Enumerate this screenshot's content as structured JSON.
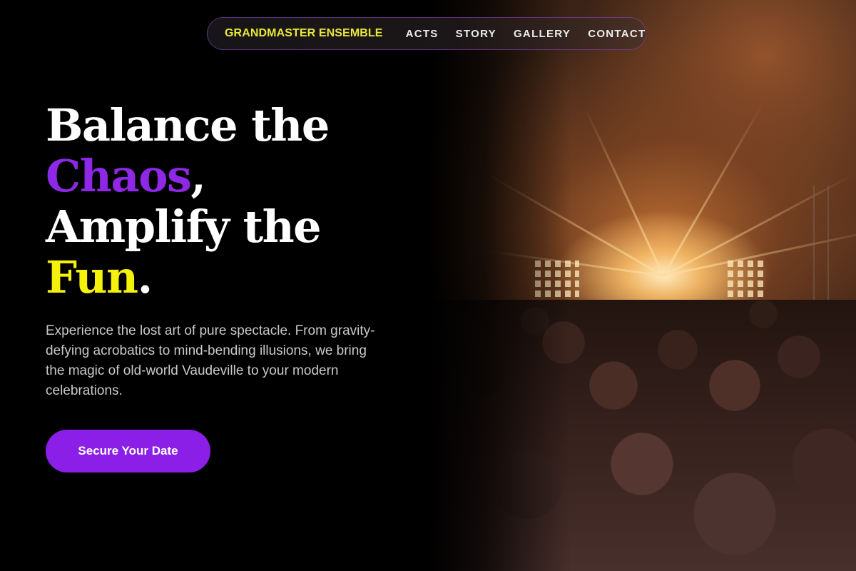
{
  "nav": {
    "brand": "GRANDMASTER ENSEMBLE",
    "links": [
      "ACTS",
      "STORY",
      "GALLERY",
      "CONTACT"
    ]
  },
  "hero": {
    "line1": "Balance the",
    "line2_highlight": "Chaos",
    "line2_suffix": ",",
    "line3": "Amplify the",
    "line4_highlight": "Fun",
    "line4_suffix": ".",
    "description": "Experience the lost art of pure spectacle. From gravity-defying acrobatics to mind-bending illusions, we bring the magic of old-world Vaudeville to your modern celebrations.",
    "cta_label": "Secure Your Date"
  },
  "colors": {
    "accent_purple": "#8b1fe8",
    "accent_yellow": "#f5f10b",
    "background": "#000000"
  },
  "image": {
    "subject": "concert-crowd-photo"
  }
}
